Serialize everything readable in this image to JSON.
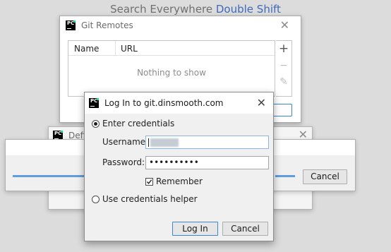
{
  "hint": {
    "text": "Search Everywhere ",
    "key": "Double Shift"
  },
  "git_remotes": {
    "title": "Git Remotes",
    "columns": [
      "Name",
      "URL"
    ],
    "empty_text": "Nothing to show",
    "side_buttons": {
      "add": "+",
      "remove": "−",
      "edit": "✎"
    },
    "close": "✕"
  },
  "define_dialog": {
    "title_partial": "Defi",
    "close": "✕"
  },
  "progress_dialog": {
    "progress": 0.22,
    "cancel_label": "Cancel"
  },
  "login": {
    "title": "Log In to git.dinsmooth.com",
    "close": "✕",
    "option_credentials": "Enter credentials",
    "username_label": "Username:",
    "password_label": "Password:",
    "password_value": "••••••••••",
    "remember_label": "Remember",
    "option_helper": "Use credentials helper",
    "login_button": "Log In",
    "cancel_button": "Cancel"
  },
  "logo_text": "PC",
  "colors": {
    "accent": "#3d86d6",
    "progress": "#5d9de0",
    "key_hint": "#3e6ab8"
  }
}
